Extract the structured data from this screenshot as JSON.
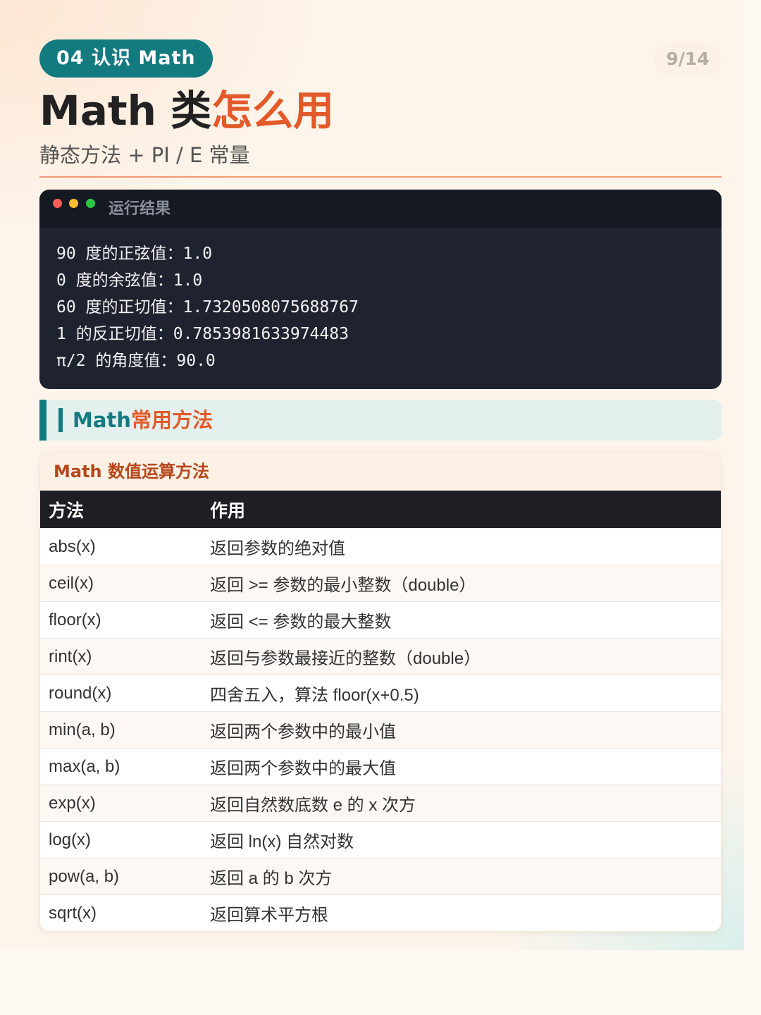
{
  "header": {
    "tag": "04 认识 Math",
    "page_number": "9/14",
    "title_main": "Math 类",
    "title_accent": "怎么用",
    "subtitle": "静态方法 + PI / E 常量"
  },
  "colors": {
    "teal": "#137a80",
    "accent": "#e35a2a",
    "terminal_bg": "#1f2330"
  },
  "terminal": {
    "title": "运行结果",
    "lines": [
      "90 度的正弦值：1.0",
      "0 度的余弦值：1.0",
      "60 度的正切值：1.7320508075688767",
      "1 的反正切值：0.7853981633974483",
      "π/2 的角度值：90.0"
    ]
  },
  "section": {
    "title_part1": "Math",
    "title_part2": "常用方法"
  },
  "table_card": {
    "title": "Math 数值运算方法",
    "headers": [
      "方法",
      "作用"
    ],
    "rows": [
      [
        "abs(x)",
        "返回参数的绝对值"
      ],
      [
        "ceil(x)",
        "返回 >= 参数的最小整数（double）"
      ],
      [
        "floor(x)",
        "返回 <= 参数的最大整数"
      ],
      [
        "rint(x)",
        "返回与参数最接近的整数（double）"
      ],
      [
        "round(x)",
        "四舍五入，算法 floor(x+0.5)"
      ],
      [
        "min(a, b)",
        "返回两个参数中的最小值"
      ],
      [
        "max(a, b)",
        "返回两个参数中的最大值"
      ],
      [
        "exp(x)",
        "返回自然数底数 e 的 x 次方"
      ],
      [
        "log(x)",
        "返回 ln(x) 自然对数"
      ],
      [
        "pow(a, b)",
        "返回 a 的 b 次方"
      ],
      [
        "sqrt(x)",
        "返回算术平方根"
      ]
    ]
  }
}
